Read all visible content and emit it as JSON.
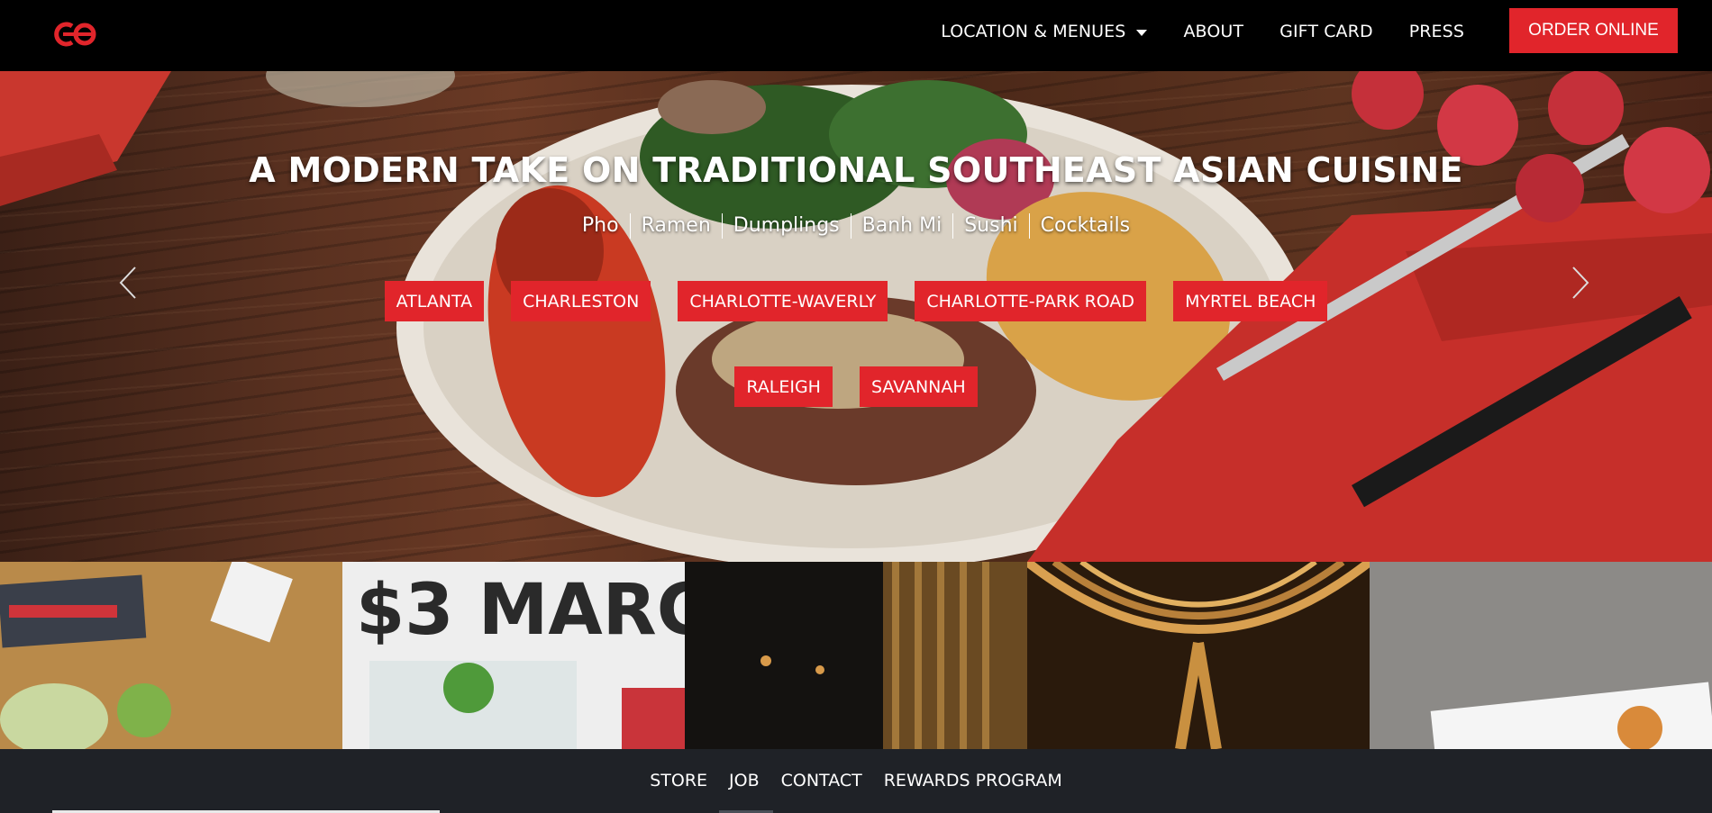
{
  "brand": {
    "logo_text": "CO",
    "accent_color": "#e1252b"
  },
  "nav": {
    "items": [
      {
        "label": "LOCATION & MENUES",
        "has_dropdown": true
      },
      {
        "label": "ABOUT"
      },
      {
        "label": "GIFT CARD"
      },
      {
        "label": "PRESS"
      }
    ],
    "order_label": "ORDER ONLINE"
  },
  "hero": {
    "title": "A MODERN TAKE ON TRADITIONAL SOUTHEAST ASIAN CUISINE",
    "cuisines": [
      "Pho",
      "Ramen",
      "Dumplings",
      "Banh Mi",
      "Sushi",
      "Cocktails"
    ],
    "locations_row1": [
      "ATLANTA",
      "CHARLESTON",
      "CHARLOTTE-WAVERLY",
      "CHARLOTTE-PARK ROAD",
      "MYRTEL BEACH"
    ],
    "locations_row2": [
      "RALEIGH",
      "SAVANNAH"
    ],
    "prev_icon": "chevron-left-icon",
    "next_icon": "chevron-right-icon"
  },
  "gallery": {
    "promo_text": "$3 MARG"
  },
  "footer": {
    "links": [
      "STORE",
      "JOB",
      "CONTACT",
      "REWARDS PROGRAM"
    ]
  }
}
